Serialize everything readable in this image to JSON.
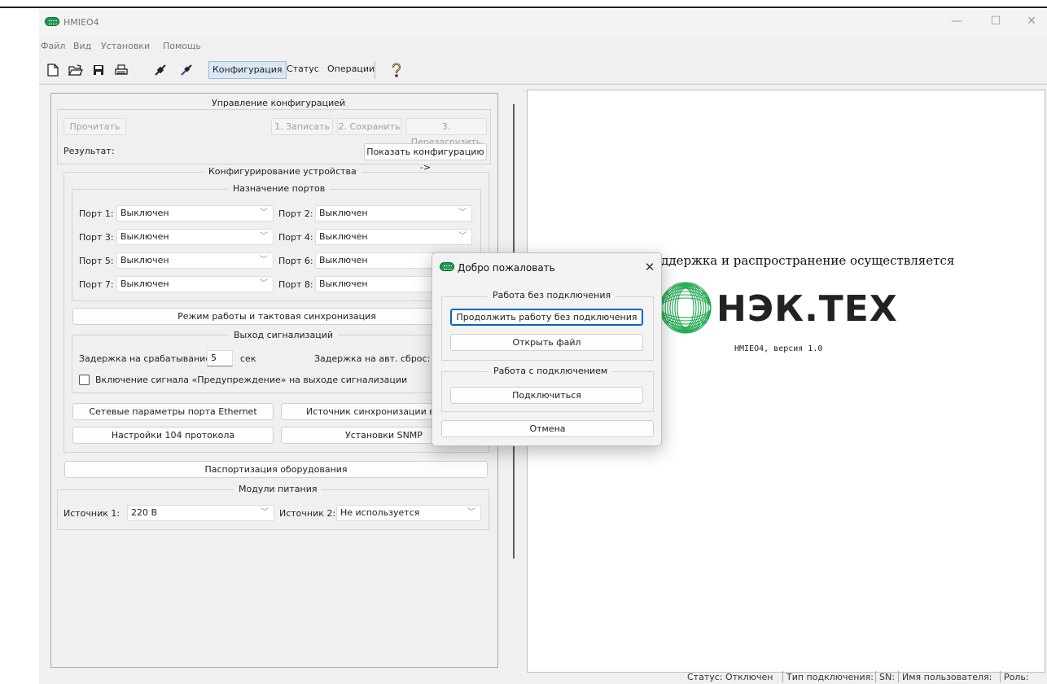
{
  "window": {
    "title": "HMIEO4",
    "controls": {
      "minimize": "—",
      "maximize": "☐",
      "close": "✕"
    }
  },
  "menu": [
    "Файл",
    "Вид",
    "Установки",
    "Помощь"
  ],
  "toolbar": {
    "icons": [
      "new-file-icon",
      "open-folder-icon",
      "save-icon",
      "print-icon",
      "disconnect-icon",
      "connect-icon",
      "help-icon"
    ],
    "tabs": [
      "Конфигурация",
      "Статус",
      "Операции"
    ],
    "active_tab": "Конфигурация"
  },
  "config": {
    "title": "Управление конфигурацией",
    "read": "Прочитать",
    "write": "1. Записать",
    "save": "2. Сохранить",
    "reboot": "3. Перезагрузить",
    "result_label": "Результат:",
    "show_config": "Показать конфигурацию ->"
  },
  "device": {
    "title": "Конфигурирование устройства",
    "ports_title": "Назначение портов",
    "ports": [
      {
        "label": "Порт 1:",
        "value": "Выключен"
      },
      {
        "label": "Порт 2:",
        "value": "Выключен"
      },
      {
        "label": "Порт 3:",
        "value": "Выключен"
      },
      {
        "label": "Порт 4:",
        "value": "Выключен"
      },
      {
        "label": "Порт 5:",
        "value": "Выключен"
      },
      {
        "label": "Порт 6:",
        "value": "Выключен"
      },
      {
        "label": "Порт 7:",
        "value": "Выключен"
      },
      {
        "label": "Порт 8:",
        "value": "Выключен"
      }
    ],
    "mode_button": "Режим работы и тактовая синхронизация",
    "alarm_title": "Выход сигнализаций",
    "delay_on_label": "Задержка на срабатывание:",
    "delay_on_value": "5",
    "delay_unit": "сек",
    "delay_reset_label": "Задержка на авт. сброс:",
    "warning_checkbox": "Включение сигнала «Предупреждение» на выходе сигнализации",
    "ethernet_button": "Сетевые параметры порта Ethernet",
    "time_source_button": "Источник синхронизации вре",
    "protocol_button": "Настройки 104 протокола",
    "snmp_button": "Установки SNMP"
  },
  "passport_button": "Паспортизация оборудования",
  "power": {
    "title": "Модули питания",
    "source1_label": "Источник 1:",
    "source1_value": "220 В",
    "source2_label": "Источник 2:",
    "source2_value": "Не используется"
  },
  "dialog": {
    "title": "Добро пожаловать",
    "offline_group": "Работа без подключения",
    "continue_offline": "Продолжить работу без подключения",
    "open_file": "Открыть файл",
    "online_group": "Работа с подключением",
    "connect": "Подключиться",
    "cancel": "Отмена"
  },
  "right": {
    "support_text": "Поддержка и распространение осуществляется",
    "brand": "НЭК.ТЕХ",
    "version": "HMIEO4, версия 1.0",
    "logo_color": "#1fa84f"
  },
  "status": {
    "status": "Статус: Отключен",
    "connection_type": "Тип подключения:",
    "sn": "SN:",
    "user": "Имя пользователя:",
    "role": "Роль:"
  }
}
